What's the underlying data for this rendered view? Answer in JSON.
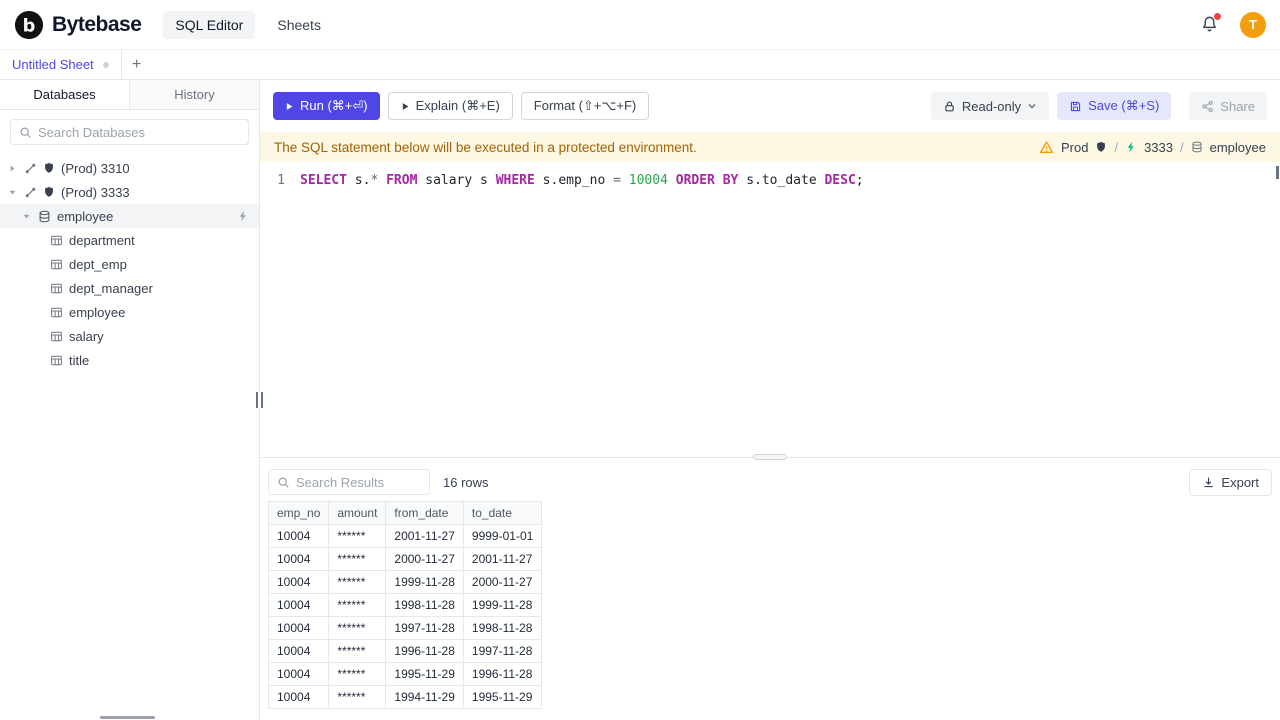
{
  "colors": {
    "accent": "#4f46e5",
    "warning_bg": "#fcf8e3",
    "warning_text": "#a16207",
    "avatar_bg": "#f59e0b",
    "sql_keyword": "#a626a4",
    "sql_number": "#2da44e"
  },
  "header": {
    "brand": "Bytebase",
    "nav": [
      {
        "label": "SQL Editor",
        "active": true
      },
      {
        "label": "Sheets",
        "active": false
      }
    ],
    "avatar_letter": "T"
  },
  "sheet_tabs": {
    "active_tab": "Untitled Sheet",
    "add_button": "+"
  },
  "sidebar": {
    "tabs": [
      {
        "label": "Databases",
        "active": true
      },
      {
        "label": "History",
        "active": false
      }
    ],
    "search_placeholder": "Search Databases",
    "tree": [
      {
        "type": "instance",
        "label": "(Prod) 3310",
        "expanded": false
      },
      {
        "type": "instance",
        "label": "(Prod) 3333",
        "expanded": true
      },
      {
        "type": "database",
        "label": "employee",
        "expanded": true,
        "selected": true
      },
      {
        "type": "table",
        "label": "department"
      },
      {
        "type": "table",
        "label": "dept_emp"
      },
      {
        "type": "table",
        "label": "dept_manager"
      },
      {
        "type": "table",
        "label": "employee"
      },
      {
        "type": "table",
        "label": "salary"
      },
      {
        "type": "table",
        "label": "title"
      }
    ]
  },
  "toolbar": {
    "run": "Run (⌘+⏎)",
    "explain": "Explain (⌘+E)",
    "format": "Format (⇧+⌥+F)",
    "readonly": "Read-only",
    "save": "Save (⌘+S)",
    "share": "Share"
  },
  "banner": {
    "message": "The SQL statement below will be executed in a protected environment.",
    "environment": "Prod",
    "separator": "/",
    "instance": "3333",
    "database": "employee"
  },
  "editor": {
    "line_number": "1",
    "sql_text": "SELECT s.* FROM salary s WHERE s.emp_no = 10004 ORDER BY s.to_date DESC;",
    "tokens": [
      {
        "text": "SELECT",
        "type": "keyword"
      },
      {
        "text": " s.",
        "type": "plain"
      },
      {
        "text": "*",
        "type": "operator"
      },
      {
        "text": " ",
        "type": "plain"
      },
      {
        "text": "FROM",
        "type": "keyword"
      },
      {
        "text": " salary s ",
        "type": "plain"
      },
      {
        "text": "WHERE",
        "type": "keyword"
      },
      {
        "text": " s.emp_no ",
        "type": "plain"
      },
      {
        "text": "=",
        "type": "operator"
      },
      {
        "text": " ",
        "type": "plain"
      },
      {
        "text": "10004",
        "type": "number"
      },
      {
        "text": " ",
        "type": "plain"
      },
      {
        "text": "ORDER BY",
        "type": "keyword"
      },
      {
        "text": " s.to_date ",
        "type": "plain"
      },
      {
        "text": "DESC",
        "type": "keyword"
      },
      {
        "text": ";",
        "type": "plain"
      }
    ]
  },
  "results": {
    "search_placeholder": "Search Results",
    "row_count": "16 rows",
    "export": "Export",
    "columns": [
      "emp_no",
      "amount",
      "from_date",
      "to_date"
    ],
    "rows": [
      [
        "10004",
        "******",
        "2001-11-27",
        "9999-01-01"
      ],
      [
        "10004",
        "******",
        "2000-11-27",
        "2001-11-27"
      ],
      [
        "10004",
        "******",
        "1999-11-28",
        "2000-11-27"
      ],
      [
        "10004",
        "******",
        "1998-11-28",
        "1999-11-28"
      ],
      [
        "10004",
        "******",
        "1997-11-28",
        "1998-11-28"
      ],
      [
        "10004",
        "******",
        "1996-11-28",
        "1997-11-28"
      ],
      [
        "10004",
        "******",
        "1995-11-29",
        "1996-11-28"
      ],
      [
        "10004",
        "******",
        "1994-11-29",
        "1995-11-29"
      ]
    ]
  }
}
